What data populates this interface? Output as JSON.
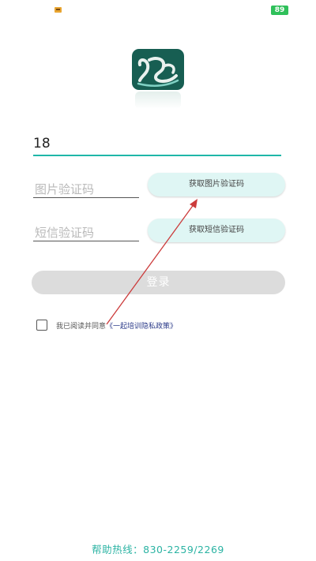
{
  "status_bar": {
    "battery_level": "89"
  },
  "logo": {
    "icon": "app-logo-icon",
    "brand_color": "#175e52"
  },
  "phone_field": {
    "value": "18"
  },
  "image_captcha": {
    "placeholder": "图片验证码",
    "button_label": "获取图片验证码"
  },
  "sms_code": {
    "placeholder": "短信验证码",
    "button_label": "获取短信验证码"
  },
  "login_button": {
    "label": "登录"
  },
  "agreement": {
    "prefix": "我已阅读并同意",
    "policy_link": "《一起培训隐私政策》",
    "checked": false
  },
  "hotline": {
    "label": "帮助热线：830-2259/2269"
  },
  "colors": {
    "accent": "#1fb7a8",
    "button_bg": "#dff6f4",
    "disabled_button": "#dcdcdc",
    "annotation_arrow": "#cc3b3b"
  }
}
